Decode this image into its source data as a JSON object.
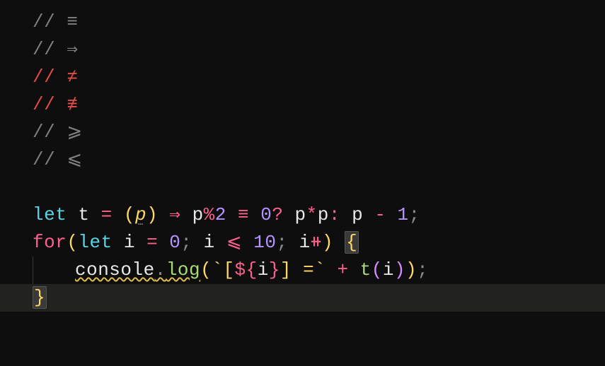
{
  "comments": {
    "l1": {
      "slashes": "//",
      "sym": "≡"
    },
    "l2": {
      "slashes": "//",
      "sym": "⇒"
    },
    "l3": {
      "slashes": "//",
      "sym": "≠"
    },
    "l4": {
      "slashes": "//",
      "sym": "≢"
    },
    "l5": {
      "slashes": "//",
      "sym": "⩾"
    },
    "l6": {
      "slashes": "//",
      "sym": "⩽"
    }
  },
  "code": {
    "let1": "let",
    "t": "t",
    "eq": "=",
    "p_param": "p",
    "arrow": "⇒",
    "p1": "p",
    "mod": "%",
    "two": "2",
    "tripleeq": "≡",
    "zero": "0",
    "qmark": "?",
    "p2": "p",
    "star": "*",
    "p3": "p",
    "colon": ":",
    "p4": "p",
    "minus": "-",
    "one": "1",
    "semi": ";",
    "for": "for",
    "let2": "let",
    "i1": "i",
    "eq2": "=",
    "zero2": "0",
    "semi2": ";",
    "i2": "i",
    "le": "⩽",
    "ten": "10",
    "semi3": ";",
    "i3": "i",
    "inc": "⧺",
    "lbrace": "{",
    "console": "console",
    "dot": ".",
    "log": "log",
    "tick1": "`",
    "lbracket": "[",
    "dollar": "${",
    "i4": "i",
    "rdollar": "}",
    "rbracket": "]",
    "eqstr": " =",
    "tick2": "`",
    "plus": "+",
    "tfunc": "t",
    "i5": "i",
    "semi4": ";",
    "rbrace": "}"
  }
}
